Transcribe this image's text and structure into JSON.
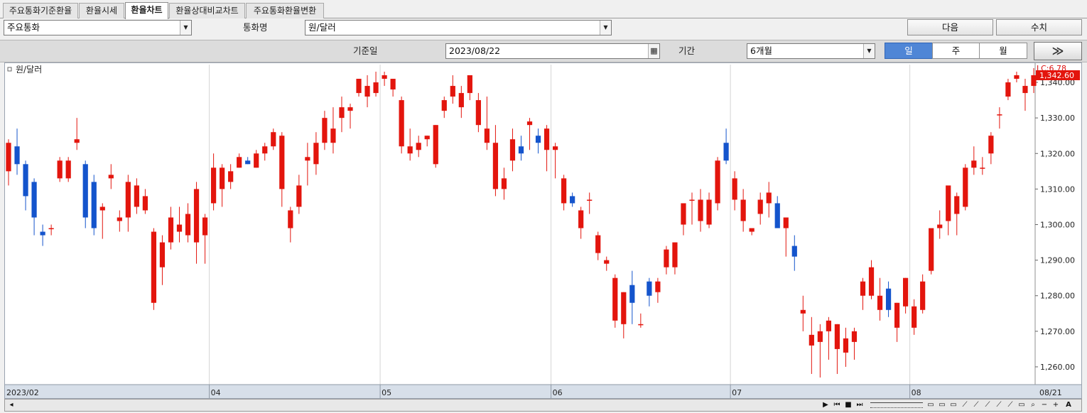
{
  "tabs": [
    "주요통화기준환율",
    "환율시세",
    "환율차트",
    "환율상대비교차트",
    "주요통화환율변환"
  ],
  "active_tab": 2,
  "toolbar": {
    "category_value": "주요통화",
    "currency_label": "통화명",
    "currency_value": "원/달러",
    "next_button": "다음",
    "values_button": "수치",
    "date_label": "기준일",
    "date_value": "2023/08/22",
    "period_label": "기간",
    "period_value": "6개월",
    "interval_day": "일",
    "interval_week": "주",
    "interval_month": "월",
    "arrow_button": "≫"
  },
  "colors": {
    "up": "#e3150d",
    "down": "#1454cc",
    "accent": "#4f86d6"
  },
  "chart_data": {
    "type": "candlestick",
    "title": "원/달러",
    "lc_label": "LC:6.78",
    "last_label": "1,342.60",
    "ylim": [
      1255,
      1345
    ],
    "y_ticks": [
      1260,
      1270,
      1280,
      1290,
      1300,
      1310,
      1320,
      1330,
      1340
    ],
    "y_tick_labels": [
      "1,260.00",
      "1,270.00",
      "1,280.00",
      "1,290.00",
      "1,300.00",
      "1,310.00",
      "1,320.00",
      "1,330.00",
      "1,340.00"
    ],
    "x_tick_labels": [
      {
        "label": "2023/02",
        "index": 0
      },
      {
        "label": "04",
        "index": 24
      },
      {
        "label": "05",
        "index": 44
      },
      {
        "label": "06",
        "index": 64
      },
      {
        "label": "07",
        "index": 85
      },
      {
        "label": "08",
        "index": 106
      },
      {
        "label": "08/21",
        "index": 121
      }
    ],
    "candles": [
      [
        1315,
        1324,
        1311,
        1323
      ],
      [
        1322,
        1327,
        1314,
        1317
      ],
      [
        1317,
        1318,
        1304,
        1308
      ],
      [
        1312,
        1313,
        1297,
        1302
      ],
      [
        1298,
        1300,
        1294,
        1297
      ],
      [
        1299,
        1300,
        1297,
        1299
      ],
      [
        1313,
        1319,
        1312,
        1318
      ],
      [
        1313,
        1319,
        1312,
        1318
      ],
      [
        1323,
        1330,
        1321,
        1324
      ],
      [
        1317,
        1318,
        1299,
        1302
      ],
      [
        1312,
        1314,
        1297,
        1299
      ],
      [
        1304,
        1306,
        1296,
        1305
      ],
      [
        1313,
        1317,
        1310,
        1314
      ],
      [
        1301,
        1304,
        1298,
        1302
      ],
      [
        1302,
        1314,
        1298,
        1312
      ],
      [
        1305,
        1313,
        1303,
        1311
      ],
      [
        1304,
        1310,
        1303,
        1308
      ],
      [
        1278,
        1299,
        1276,
        1298
      ],
      [
        1288,
        1297,
        1283,
        1295
      ],
      [
        1295,
        1305,
        1293,
        1302
      ],
      [
        1298,
        1305,
        1295,
        1300
      ],
      [
        1297,
        1306,
        1295,
        1303
      ],
      [
        1295,
        1312,
        1289,
        1310
      ],
      [
        1297,
        1303,
        1289,
        1302
      ],
      [
        1306,
        1320,
        1304,
        1316
      ],
      [
        1310,
        1317,
        1305,
        1316
      ],
      [
        1312,
        1317,
        1310,
        1315
      ],
      [
        1316,
        1320,
        1316,
        1319
      ],
      [
        1318,
        1319,
        1317,
        1317
      ],
      [
        1316,
        1321,
        1316,
        1320
      ],
      [
        1320,
        1323,
        1318,
        1322
      ],
      [
        1322,
        1327,
        1321,
        1326
      ],
      [
        1310,
        1326,
        1305,
        1325
      ],
      [
        1299,
        1305,
        1295,
        1304
      ],
      [
        1305,
        1314,
        1303,
        1311
      ],
      [
        1318,
        1323,
        1311,
        1319
      ],
      [
        1317,
        1326,
        1314,
        1323
      ],
      [
        1323,
        1332,
        1321,
        1330
      ],
      [
        1323,
        1333,
        1320,
        1327
      ],
      [
        1330,
        1336,
        1326,
        1333
      ],
      [
        1332,
        1334,
        1327,
        1333
      ],
      [
        1337,
        1341,
        1336,
        1341
      ],
      [
        1336,
        1342,
        1333,
        1339
      ],
      [
        1337,
        1343,
        1336,
        1340
      ],
      [
        1341,
        1343,
        1339,
        1342
      ],
      [
        1338,
        1341,
        1336,
        1341
      ],
      [
        1322,
        1336,
        1320,
        1335
      ],
      [
        1320,
        1327,
        1318,
        1322
      ],
      [
        1321,
        1325,
        1319,
        1323
      ],
      [
        1324,
        1325,
        1322,
        1325
      ],
      [
        1317,
        1328,
        1316,
        1328
      ],
      [
        1332,
        1336,
        1330,
        1335
      ],
      [
        1336,
        1342,
        1334,
        1339
      ],
      [
        1333,
        1339,
        1330,
        1337
      ],
      [
        1337,
        1341,
        1335,
        1342
      ],
      [
        1328,
        1337,
        1326,
        1335
      ],
      [
        1323,
        1336,
        1321,
        1327
      ],
      [
        1310,
        1328,
        1308,
        1323
      ],
      [
        1310,
        1316,
        1307,
        1313
      ],
      [
        1318,
        1327,
        1315,
        1324
      ],
      [
        1322,
        1325,
        1318,
        1320
      ],
      [
        1328,
        1330,
        1321,
        1329
      ],
      [
        1325,
        1327,
        1320,
        1323
      ],
      [
        1321,
        1328,
        1315,
        1327
      ],
      [
        1321,
        1323,
        1313,
        1322
      ],
      [
        1306,
        1314,
        1304,
        1313
      ],
      [
        1308,
        1309,
        1305,
        1306
      ],
      [
        1299,
        1305,
        1296,
        1304
      ],
      [
        1307,
        1309,
        1303,
        1307
      ],
      [
        1292,
        1298,
        1290,
        1297
      ],
      [
        1289,
        1291,
        1287,
        1290
      ],
      [
        1273,
        1286,
        1271,
        1285
      ],
      [
        1272,
        1281,
        1268,
        1281
      ],
      [
        1283,
        1287,
        1272,
        1278
      ],
      [
        1272,
        1275,
        1271,
        1272
      ],
      [
        1284,
        1285,
        1277,
        1280
      ],
      [
        1281,
        1285,
        1278,
        1284
      ],
      [
        1288,
        1294,
        1286,
        1293
      ],
      [
        1288,
        1295,
        1286,
        1295
      ],
      [
        1300,
        1302,
        1297,
        1306
      ],
      [
        1307,
        1309,
        1300,
        1307
      ],
      [
        1301,
        1310,
        1298,
        1307
      ],
      [
        1300,
        1309,
        1299,
        1307
      ],
      [
        1306,
        1319,
        1304,
        1318
      ],
      [
        1323,
        1327,
        1317,
        1318
      ],
      [
        1307,
        1315,
        1304,
        1313
      ],
      [
        1301,
        1310,
        1298,
        1307
      ],
      [
        1298,
        1299,
        1297,
        1299
      ],
      [
        1303,
        1309,
        1300,
        1307
      ],
      [
        1306,
        1312,
        1302,
        1309
      ],
      [
        1306,
        1308,
        1300,
        1299
      ],
      [
        1299,
        1302,
        1291,
        1302
      ],
      [
        1294,
        1297,
        1287,
        1291
      ],
      [
        1275,
        1280,
        1270,
        1276
      ],
      [
        1266,
        1274,
        1258,
        1269
      ],
      [
        1267,
        1272,
        1257,
        1270
      ],
      [
        1270,
        1274,
        1262,
        1273
      ],
      [
        1265,
        1272,
        1258,
        1272
      ],
      [
        1264,
        1271,
        1260,
        1268
      ],
      [
        1267,
        1271,
        1262,
        1270
      ],
      [
        1280,
        1285,
        1276,
        1284
      ],
      [
        1280,
        1290,
        1279,
        1288
      ],
      [
        1276,
        1285,
        1273,
        1280
      ],
      [
        1282,
        1284,
        1274,
        1276
      ],
      [
        1271,
        1278,
        1267,
        1278
      ],
      [
        1277,
        1285,
        1275,
        1285
      ],
      [
        1271,
        1279,
        1269,
        1277
      ],
      [
        1276,
        1286,
        1275,
        1284
      ],
      [
        1287,
        1299,
        1286,
        1299
      ],
      [
        1299,
        1304,
        1296,
        1300
      ],
      [
        1301,
        1310,
        1297,
        1311
      ],
      [
        1303,
        1309,
        1297,
        1308
      ],
      [
        1305,
        1317,
        1304,
        1316
      ],
      [
        1316,
        1322,
        1314,
        1318
      ],
      [
        1316,
        1319,
        1314,
        1316
      ],
      [
        1320,
        1326,
        1317,
        1325
      ],
      [
        1331,
        1333,
        1327,
        1331
      ],
      [
        1336,
        1341,
        1335,
        1340
      ],
      [
        1341,
        1343,
        1340,
        1342
      ],
      [
        1337,
        1341,
        1332,
        1339
      ],
      [
        1339,
        1344,
        1337,
        1342
      ]
    ]
  },
  "bottom_controls": [
    "▶",
    "⏮",
    "■",
    "⏭"
  ]
}
